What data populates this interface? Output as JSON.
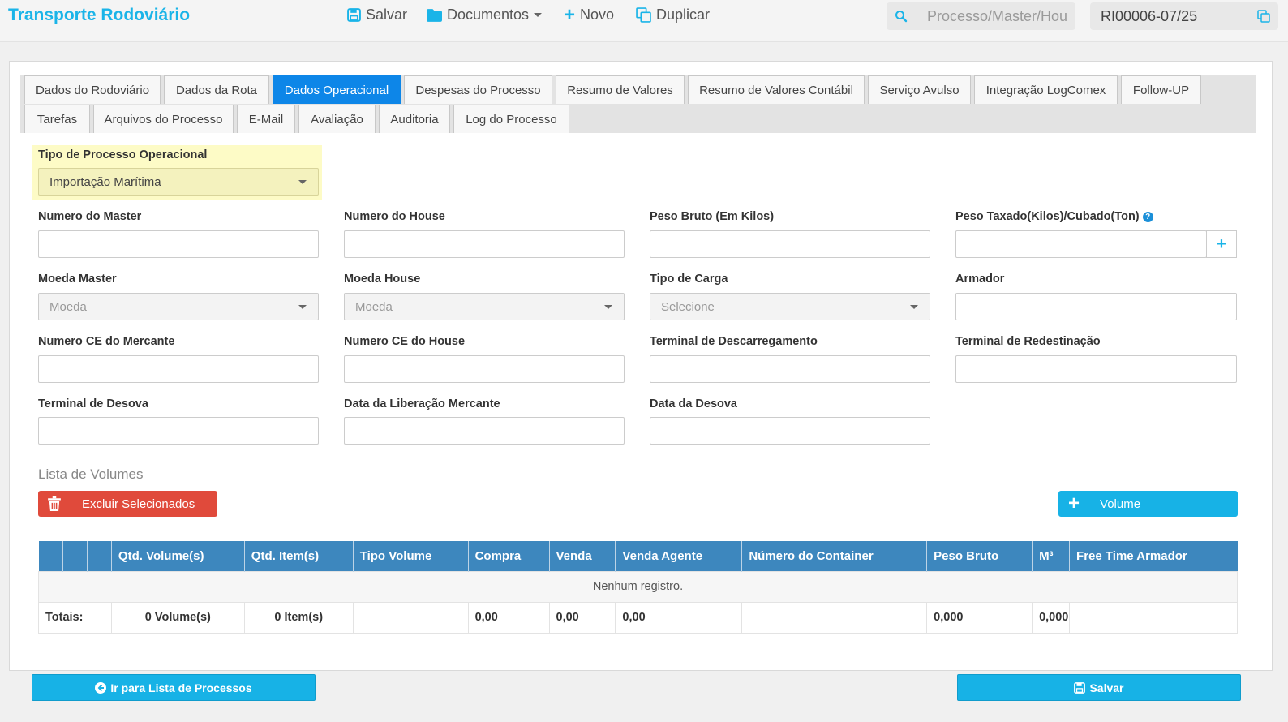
{
  "app": {
    "title": "Transporte Rodoviário"
  },
  "toolbar": {
    "save_label": "Salvar",
    "documents_label": "Documentos",
    "new_label": "Novo",
    "duplicate_label": "Duplicar",
    "search_placeholder": "Processo/Master/House",
    "process_number": "RI00006-07/25"
  },
  "tabs": {
    "row1": [
      "Dados do Rodoviário",
      "Dados da Rota",
      "Dados Operacional",
      "Despesas do Processo",
      "Resumo de Valores",
      "Resumo de Valores Contábil",
      "Serviço Avulso",
      "Integração LogComex",
      "Follow-UP"
    ],
    "row2": [
      "Tarefas",
      "Arquivos do Processo",
      "E-Mail",
      "Avaliação",
      "Auditoria",
      "Log do Processo"
    ],
    "active": "Dados Operacional"
  },
  "form": {
    "tipo_processo_label": "Tipo de Processo Operacional",
    "tipo_processo_value": "Importação Marítima",
    "numero_master_label": "Numero do Master",
    "numero_house_label": "Numero do House",
    "peso_bruto_label": "Peso Bruto (Em Kilos)",
    "peso_taxado_label": "Peso Taxado(Kilos)/Cubado(Ton)",
    "moeda_master_label": "Moeda Master",
    "moeda_master_value": "Moeda",
    "moeda_house_label": "Moeda House",
    "moeda_house_value": "Moeda",
    "tipo_carga_label": "Tipo de Carga",
    "tipo_carga_value": "Selecione",
    "armador_label": "Armador",
    "ce_mercante_label": "Numero CE do Mercante",
    "ce_house_label": "Numero CE do House",
    "terminal_descarregamento_label": "Terminal de Descarregamento",
    "terminal_redestinacao_label": "Terminal de Redestinação",
    "terminal_desova_label": "Terminal de Desova",
    "data_liberacao_label": "Data da Liberação Mercante",
    "data_desova_label": "Data da Desova"
  },
  "volumes": {
    "title": "Lista de Volumes",
    "delete_label": "Excluir Selecionados",
    "add_label": "Volume",
    "columns": [
      "",
      "",
      "",
      "Qtd. Volume(s)",
      "Qtd. Item(s)",
      "Tipo Volume",
      "Compra",
      "Venda",
      "Venda Agente",
      "Número do Container",
      "Peso Bruto",
      "M³",
      "Free Time Armador"
    ],
    "empty_message": "Nenhum registro.",
    "totals": {
      "label": "Totais:",
      "volumes": "0 Volume(s)",
      "items": "0 Item(s)",
      "compra": "0,00",
      "venda": "0,00",
      "venda_agente": "0,00",
      "peso_bruto": "0,000",
      "m3": "0,000"
    }
  },
  "footer": {
    "back_label": "Ir para Lista de Processos",
    "save_label": "Salvar"
  },
  "colors": {
    "accent": "#1ab4e8",
    "tab_active": "#0d86e8",
    "table_header": "#3d87be",
    "danger": "#e04a3b",
    "highlight": "#fdfbc6"
  }
}
